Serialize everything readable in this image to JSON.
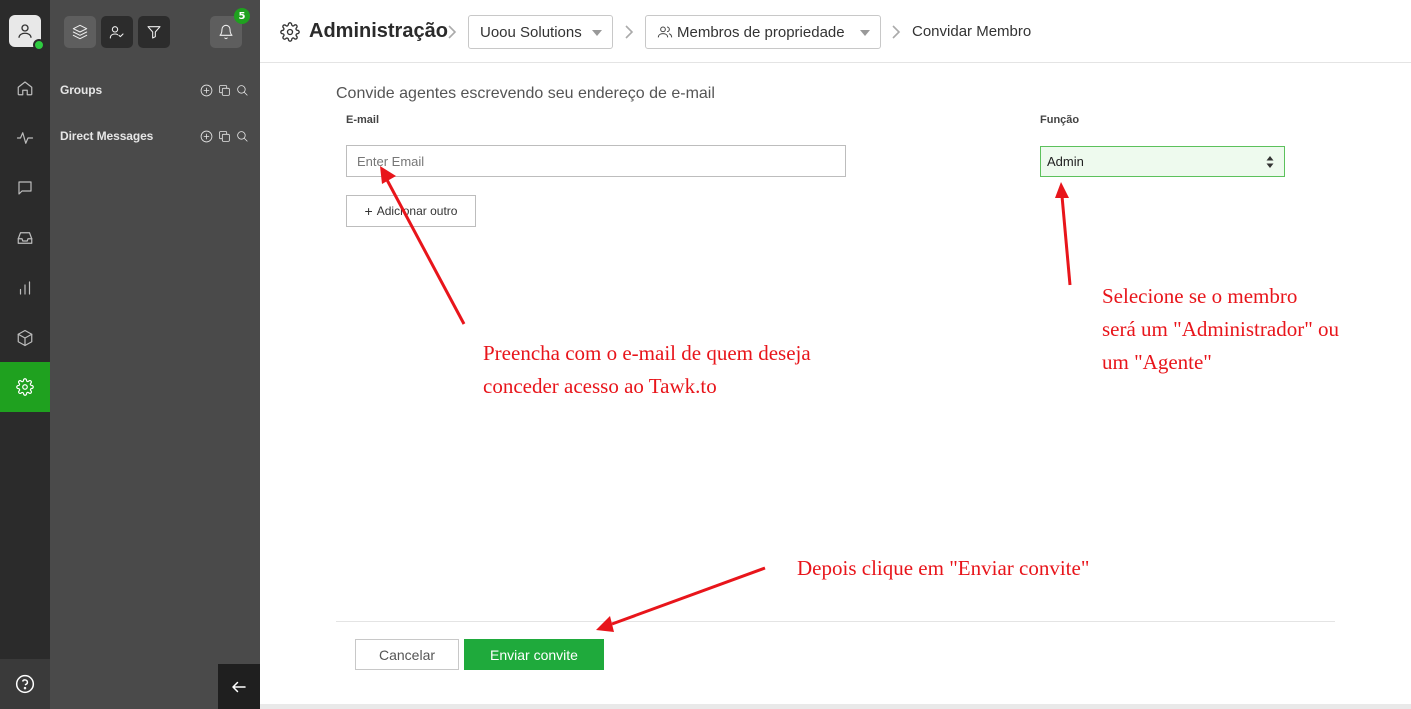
{
  "rail": {
    "items": [
      {
        "name": "home-icon"
      },
      {
        "name": "activity-icon"
      },
      {
        "name": "chat-icon"
      },
      {
        "name": "inbox-icon"
      },
      {
        "name": "reports-icon"
      },
      {
        "name": "addons-icon"
      },
      {
        "name": "settings-icon",
        "active": true
      }
    ]
  },
  "panel": {
    "notification_count": "5",
    "sections": [
      {
        "label": "Groups"
      },
      {
        "label": "Direct Messages"
      }
    ]
  },
  "breadcrumb": {
    "title": "Administração",
    "property_select": "Uoou Solutions",
    "members_select": "Membros de propriedade",
    "current": "Convidar Membro"
  },
  "form": {
    "intro": "Convide agentes escrevendo seu endereço de e-mail",
    "email_label": "E-mail",
    "email_placeholder": "Enter Email",
    "role_label": "Função",
    "role_value": "Admin",
    "add_another": "Adicionar outro",
    "cancel": "Cancelar",
    "send": "Enviar convite"
  },
  "annotations": {
    "email_note_line1": "Preencha com o e-mail de quem deseja",
    "email_note_line2": "conceder acesso ao Tawk.to",
    "role_note_line1": "Selecione se o membro",
    "role_note_line2": "será um \"Administrador\" ou",
    "role_note_line3": "um \"Agente\"",
    "send_note": "Depois clique em \"Enviar convite\"",
    "color": "#e8151b"
  },
  "colors": {
    "accent_green": "#1fa11f",
    "send_button": "#1faa3c"
  }
}
